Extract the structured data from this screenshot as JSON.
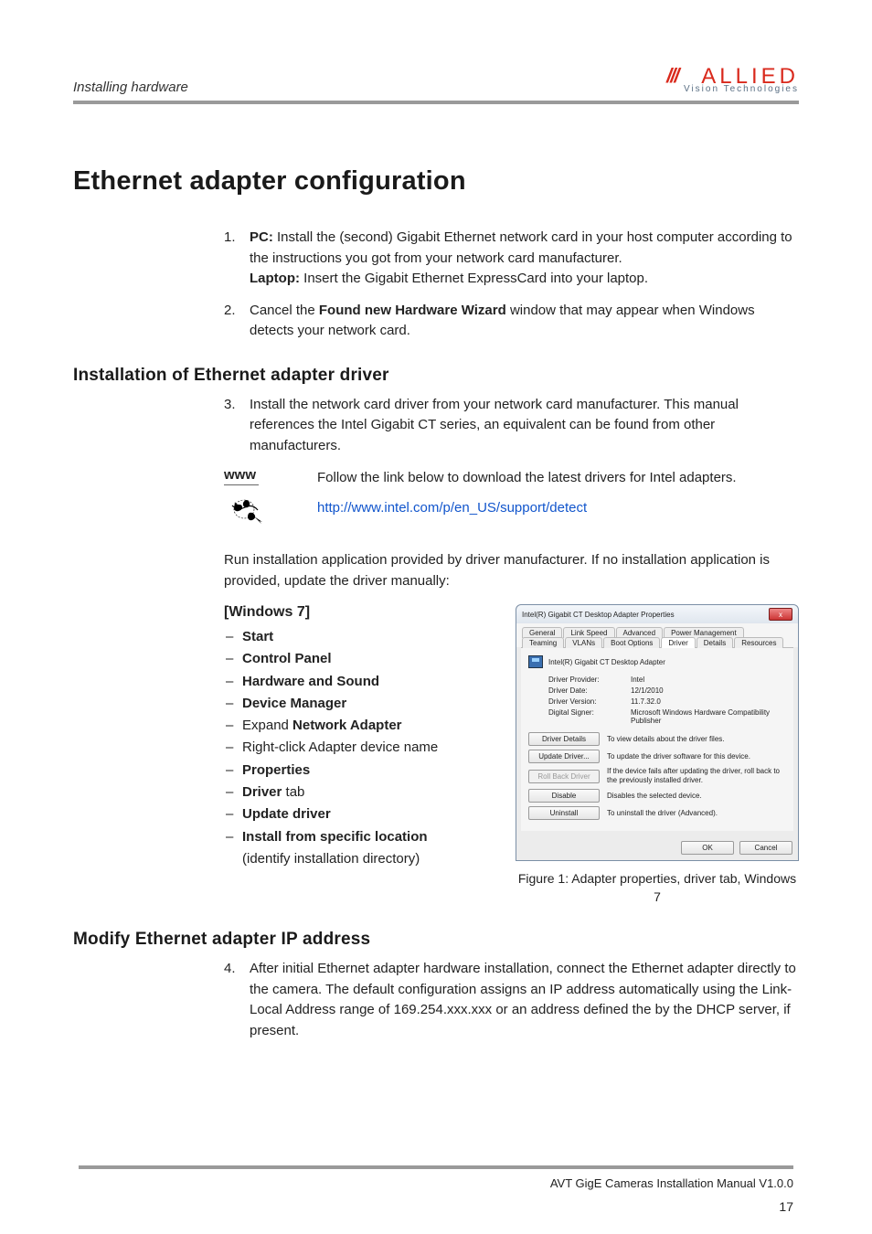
{
  "header": {
    "section": "Installing hardware",
    "logo_main": "ALLIED",
    "logo_sub": "Vision Technologies"
  },
  "h1": "Ethernet adapter configuration",
  "step1": {
    "num": "1.",
    "pc_label": "PC:",
    "pc_text": " Install the (second) Gigabit Ethernet network card in your host computer according to the instructions you got from your network card manufacturer.",
    "laptop_label": "Laptop:",
    "laptop_text": " Insert the Gigabit Ethernet ExpressCard into your laptop."
  },
  "step2": {
    "num": "2.",
    "pre": "Cancel the ",
    "bold": "Found new Hardware Wizard",
    "post": " window that may appear when Windows detects your network card."
  },
  "h2a": "Installation of Ethernet adapter driver",
  "step3": {
    "num": "3.",
    "text": "Install the network card driver from your network card manufacturer. This manual references the Intel Gigabit CT series, an equivalent can be found from other manufacturers."
  },
  "www": {
    "label": "www",
    "text": "Follow the link below to download the latest drivers for Intel adapters.",
    "url": "http://www.intel.com/p/en_US/support/detect"
  },
  "run_text": "Run installation application provided by driver manufacturer. If no installation application is provided, update the driver manually:",
  "win_h": "[Windows 7]",
  "win_items": [
    {
      "b": "Start"
    },
    {
      "b": "Control Panel"
    },
    {
      "b": "Hardware and Sound"
    },
    {
      "b": "Device Manager"
    },
    {
      "pre": "Expand ",
      "b": "Network Adapter"
    },
    {
      "plain": "Right-click Adapter device name"
    },
    {
      "b": "Properties"
    },
    {
      "b": "Driver",
      "post": " tab"
    },
    {
      "b": "Update driver"
    },
    {
      "b": "Install from specific location",
      "post2": "(identify installation directory)"
    }
  ],
  "dlg": {
    "title": "Intel(R) Gigabit CT Desktop Adapter Properties",
    "tabs_top": [
      "General",
      "Link Speed",
      "Advanced",
      "Power Management"
    ],
    "tabs_bot": [
      "Teaming",
      "VLANs",
      "Boot Options",
      "Driver",
      "Details",
      "Resources"
    ],
    "device": "Intel(R) Gigabit CT Desktop Adapter",
    "kv": [
      [
        "Driver Provider:",
        "Intel"
      ],
      [
        "Driver Date:",
        "12/1/2010"
      ],
      [
        "Driver Version:",
        "11.7.32.0"
      ],
      [
        "Digital Signer:",
        "Microsoft Windows Hardware Compatibility Publisher"
      ]
    ],
    "buttons": [
      {
        "label": "Driver Details",
        "desc": "To view details about the driver files."
      },
      {
        "label": "Update Driver...",
        "desc": "To update the driver software for this device."
      },
      {
        "label": "Roll Back Driver",
        "desc": "If the device fails after updating the driver, roll back to the previously installed driver.",
        "disabled": true
      },
      {
        "label": "Disable",
        "desc": "Disables the selected device."
      },
      {
        "label": "Uninstall",
        "desc": "To uninstall the driver (Advanced)."
      }
    ],
    "ok": "OK",
    "cancel": "Cancel"
  },
  "caption": "Figure 1: Adapter properties, driver tab, Windows 7",
  "h2b": "Modify Ethernet adapter IP address",
  "step4": {
    "num": "4.",
    "text": "After initial Ethernet adapter hardware installation, connect the Ethernet adapter directly to the camera. The default configuration assigns an IP address automatically using the Link-Local Address range of 169.254.xxx.xxx or an address defined the by the DHCP server, if present."
  },
  "footer": "AVT GigE Cameras Installation Manual V1.0.0",
  "page": "17"
}
